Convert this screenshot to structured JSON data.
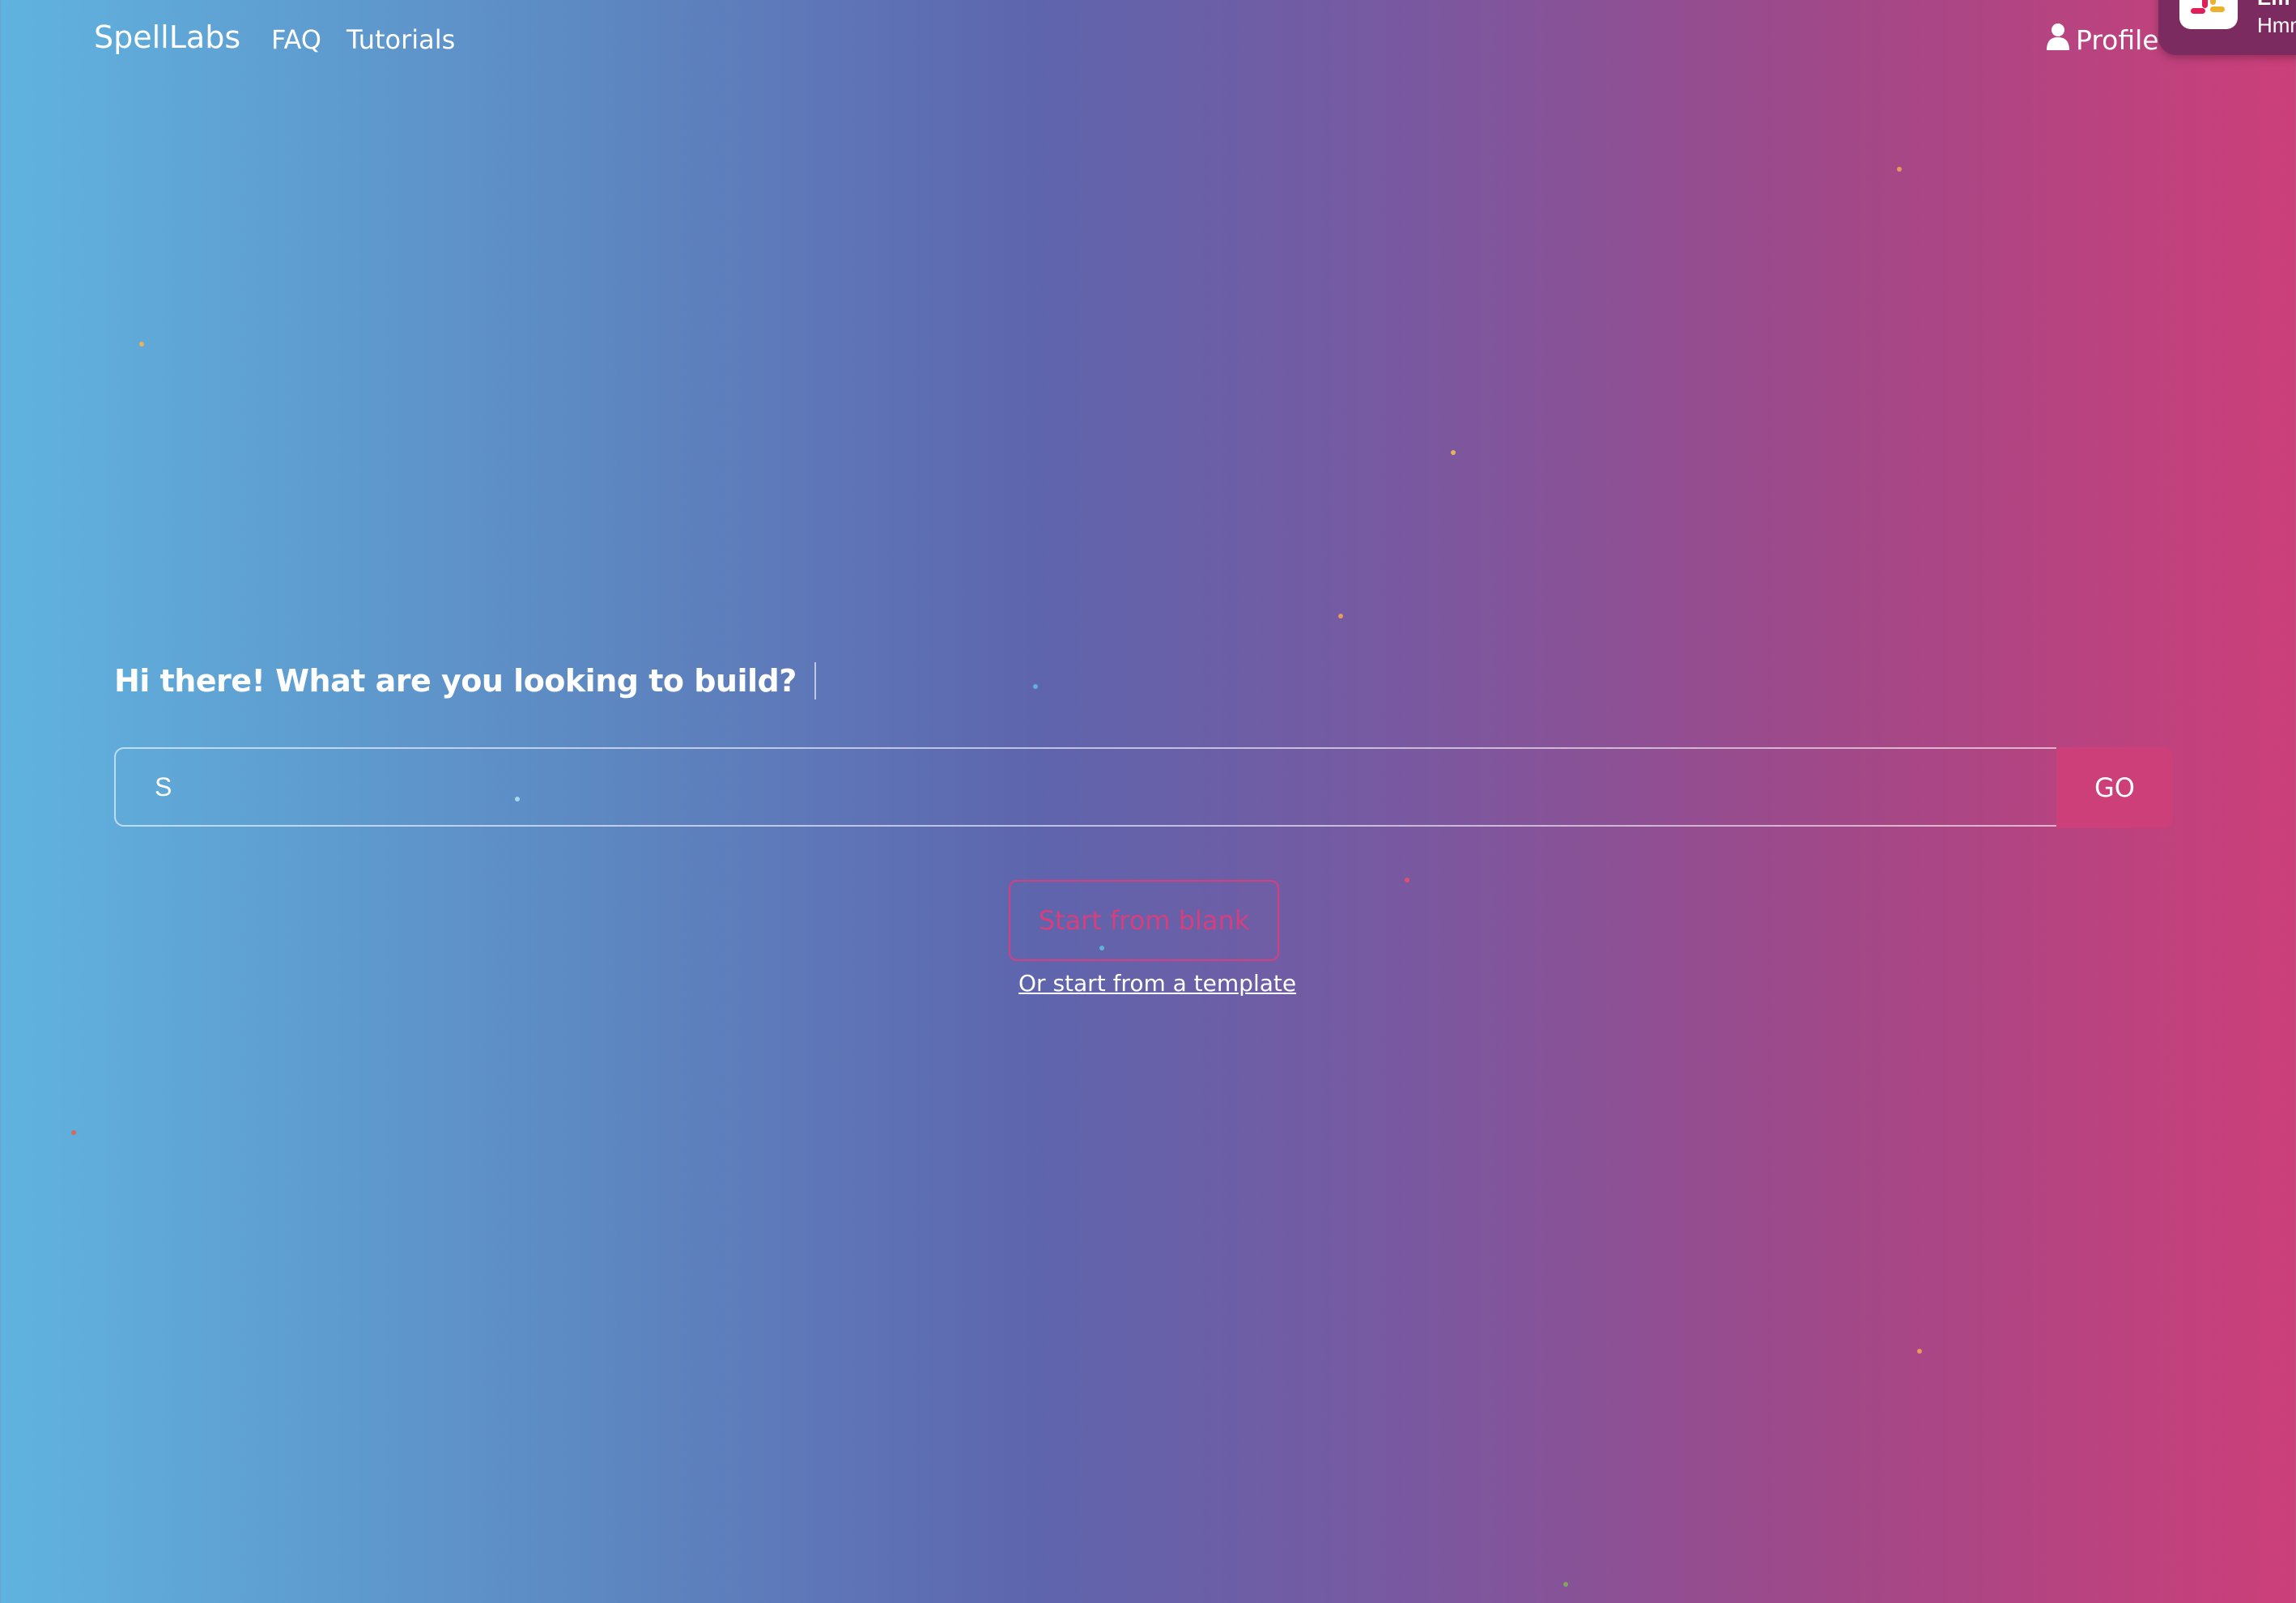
{
  "nav": {
    "brand": "SpellLabs",
    "links": [
      {
        "label": "FAQ"
      },
      {
        "label": "Tutorials"
      }
    ],
    "profile_label": "Profile",
    "profile_icon": "person-icon"
  },
  "notification": {
    "app_icon": "slack-icon",
    "title": "Em",
    "text": "Hmm"
  },
  "main": {
    "heading": "Hi there! What are you looking to build?",
    "search": {
      "value": "S",
      "go_label": "GO"
    },
    "blank_button": "Start from blank",
    "template_link": "Or start from a template"
  },
  "colors": {
    "gradient_left": "#60b3df",
    "gradient_mid": "#5e65ad",
    "gradient_right": "#cc3f79",
    "accent": "#cc3f79"
  }
}
